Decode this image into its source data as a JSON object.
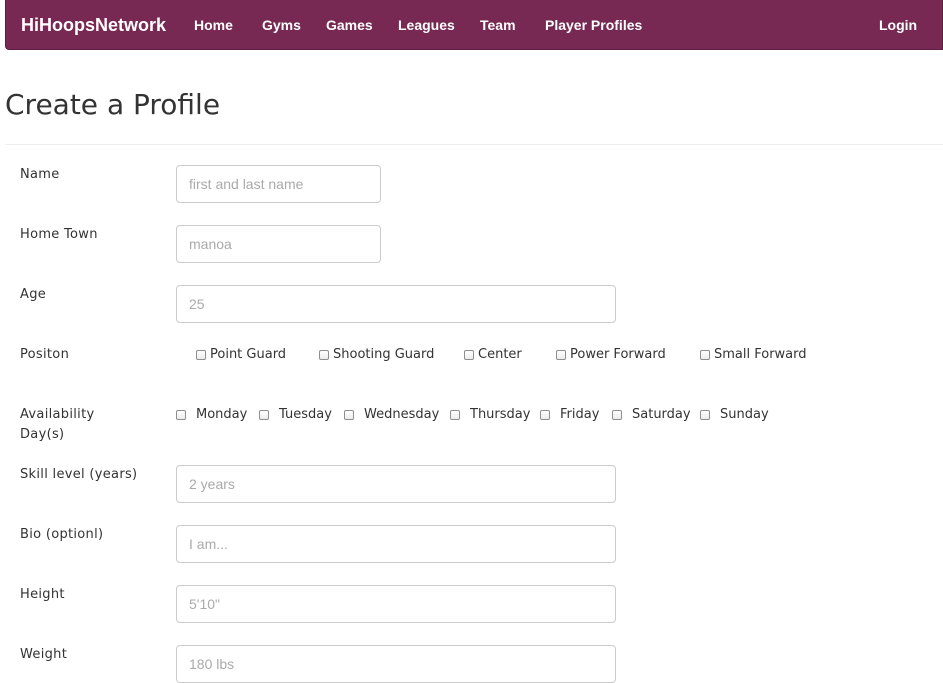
{
  "nav": {
    "brand": "HiHoopsNetwork",
    "links": [
      "Home",
      "Gyms",
      "Games",
      "Leagues",
      "Team",
      "Player Profiles"
    ],
    "login": "Login",
    "bg_color": "#772953"
  },
  "page": {
    "title": "Create a Profile"
  },
  "form": {
    "name": {
      "label": "Name",
      "placeholder": "first and last name"
    },
    "hometown": {
      "label": "Home Town",
      "placeholder": "manoa"
    },
    "age": {
      "label": "Age",
      "placeholder": "25"
    },
    "position": {
      "label": "Positon",
      "options": [
        "Point Guard",
        "Shooting Guard",
        "Center",
        "Power Forward",
        "Small Forward"
      ]
    },
    "availability": {
      "label_line1": "Availability",
      "label_line2": "Day(s)",
      "days": [
        "Monday",
        "Tuesday",
        "Wednesday",
        "Thursday",
        "Friday",
        "Saturday",
        "Sunday"
      ]
    },
    "skill": {
      "label": "Skill level (years)",
      "placeholder": "2 years"
    },
    "bio": {
      "label": "Bio (optionl)",
      "placeholder": "I am..."
    },
    "height": {
      "label": "Height",
      "placeholder": "5'10\""
    },
    "weight": {
      "label": "Weight",
      "placeholder": "180 lbs"
    }
  }
}
